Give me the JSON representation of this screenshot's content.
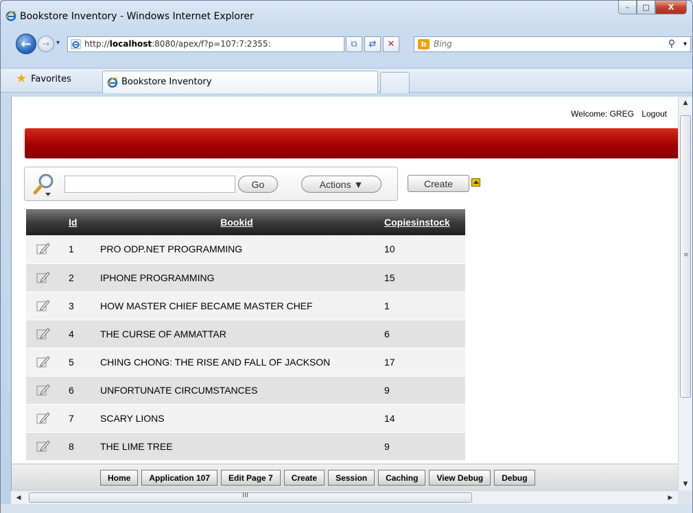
{
  "window": {
    "title": "Bookstore Inventory - Windows Internet Explorer",
    "minimize_glyph": "–",
    "maximize_glyph": "□",
    "close_glyph": "X"
  },
  "address_bar": {
    "url_prefix": "http://",
    "url_host": "localhost",
    "url_rest": ":8080/apex/f?p=107:7:2355:",
    "dropdown_glyph": "▾"
  },
  "search": {
    "provider": "b",
    "placeholder": "Bing",
    "search_glyph": "⚲",
    "dropdown_glyph": "▾"
  },
  "nav": {
    "back_glyph": "←",
    "forward_glyph": "→",
    "history_glyph": "▾",
    "compat_glyph": "⧉",
    "refresh_glyph": "⇄",
    "stop_glyph": "✕"
  },
  "favorites": {
    "label": "Favorites",
    "star_glyph": "★"
  },
  "tab": {
    "label": "Bookstore Inventory"
  },
  "header": {
    "welcome": "Welcome: GREG",
    "logout": "Logout"
  },
  "toolbar": {
    "search_value": "",
    "go_label": "Go",
    "actions_label": "Actions ▼",
    "create_label": "Create"
  },
  "table": {
    "columns": [
      "",
      "Id",
      "Bookid",
      "Copiesinstock"
    ],
    "rows": [
      {
        "id": "1",
        "bookid": "PRO ODP.NET PROGRAMMING",
        "copies": "10"
      },
      {
        "id": "2",
        "bookid": "IPHONE PROGRAMMING",
        "copies": "15"
      },
      {
        "id": "3",
        "bookid": "HOW MASTER CHIEF BECAME MASTER CHEF",
        "copies": "1"
      },
      {
        "id": "4",
        "bookid": "THE CURSE OF AMMATTAR",
        "copies": "6"
      },
      {
        "id": "5",
        "bookid": "CHING CHONG: THE RISE AND FALL OF JACKSON",
        "copies": "17"
      },
      {
        "id": "6",
        "bookid": "UNFORTUNATE CIRCUMSTANCES",
        "copies": "9"
      },
      {
        "id": "7",
        "bookid": "SCARY LIONS",
        "copies": "14"
      },
      {
        "id": "8",
        "bookid": "THE LIME TREE",
        "copies": "9"
      }
    ]
  },
  "developer_toolbar": {
    "buttons": [
      "Home",
      "Application 107",
      "Edit Page 7",
      "Create",
      "Session",
      "Caching",
      "View Debug",
      "Debug"
    ]
  },
  "scrollbars": {
    "up_glyph": "▲",
    "down_glyph": "▼",
    "left_glyph": "◀",
    "right_glyph": "▶",
    "v_grip": "≡",
    "h_grip": "III"
  },
  "colors": {
    "banner_red": "#b30000",
    "header_dark": "#3c3c3c",
    "row_light": "#f2f2f2",
    "row_dark": "#e2e2e2"
  }
}
